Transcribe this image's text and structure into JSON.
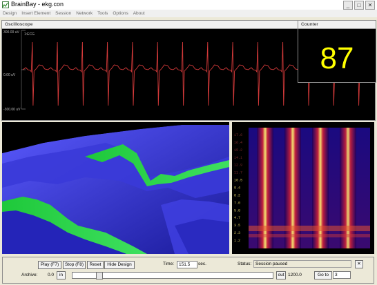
{
  "window": {
    "title": "BrainBay - ekg.con",
    "icon": "app-chart-icon",
    "buttons": [
      "minimize-icon",
      "maximize-icon",
      "close-icon"
    ]
  },
  "menu": {
    "items": [
      "Design",
      "Insert Element",
      "Session",
      "Network",
      "Tools",
      "Options",
      "About"
    ]
  },
  "oscilloscope": {
    "title": "Oscilloscope",
    "channel": "1:ECG",
    "y_top": "300.00 uV",
    "y_mid": "0.00 uV",
    "y_bottom": "-300.00 uV",
    "trace_color": "#d43a3a",
    "beat_count": 14
  },
  "counter": {
    "title": "Counter",
    "value": "87",
    "color": "#ffff00"
  },
  "spectrum": {
    "freq_labels": [
      "17.6",
      "16.4",
      "15.2",
      "14.1",
      "12.9",
      "11.7",
      "10.5",
      "9.4",
      "8.2",
      "7.0",
      "5.8",
      "4.7",
      "3.5",
      "2.3",
      "1.2"
    ]
  },
  "controls": {
    "play_label": "Play (F7)",
    "stop_label": "Stop (F8)",
    "reset_label": "Reset",
    "hide_design_label": "Hide Design",
    "time_label": "Time:",
    "time_value": "151.5",
    "time_unit": "sec.",
    "status_label": "Status:",
    "status_value": "Session paused",
    "archive_label": "Archive:",
    "archive_in_value": "0.0",
    "in_label": "in",
    "out_label": "out",
    "archive_out_value": "1200.0",
    "goto_label": "Go to",
    "goto_value": "3",
    "slider_position": 0.12
  }
}
